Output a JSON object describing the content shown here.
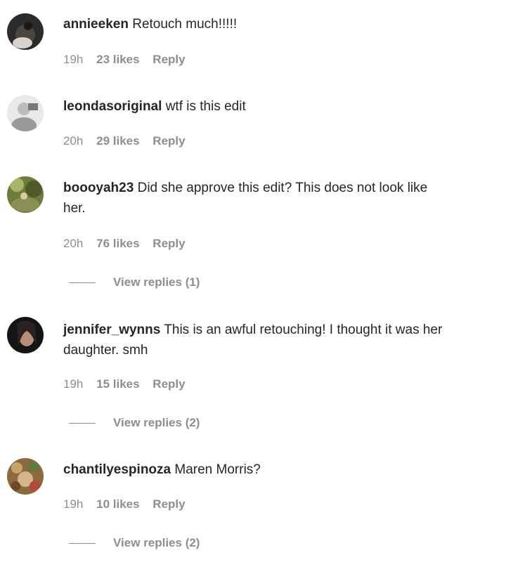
{
  "comments": [
    {
      "user": "annieeken",
      "text": "Retouch much!!!!!",
      "text_line2": "",
      "time": "19h",
      "likes": "23 likes",
      "reply": "Reply",
      "view_replies": ""
    },
    {
      "user": "leondasoriginal",
      "text": "wtf is this edit",
      "text_line2": "",
      "time": "20h",
      "likes": "29 likes",
      "reply": "Reply",
      "view_replies": ""
    },
    {
      "user": "boooyah23",
      "text": "Did she approve this edit? This does not look like",
      "text_line2": "her.",
      "time": "20h",
      "likes": "76 likes",
      "reply": "Reply",
      "view_replies": "View replies (1)"
    },
    {
      "user": "jennifer_wynns",
      "text": "This is an awful retouching! I thought it was her",
      "text_line2": "daughter. smh",
      "time": "19h",
      "likes": "15 likes",
      "reply": "Reply",
      "view_replies": "View replies (2)"
    },
    {
      "user": "chantilyespinoza",
      "text": "Maren Morris?",
      "text_line2": "",
      "time": "19h",
      "likes": "10 likes",
      "reply": "Reply",
      "view_replies": "View replies (2)"
    }
  ],
  "colors": {
    "text": "#262626",
    "muted": "#8e8e8e",
    "background": "#ffffff"
  }
}
